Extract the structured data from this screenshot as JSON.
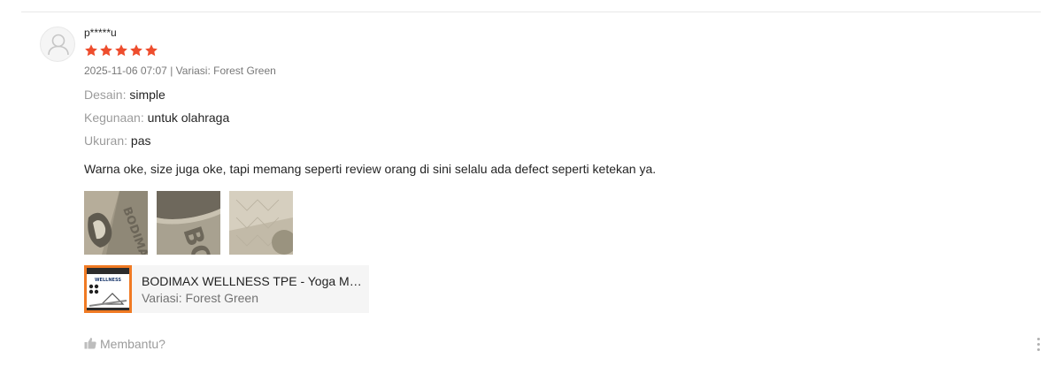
{
  "review": {
    "username": "p*****u",
    "rating": 5,
    "rating_max": 5,
    "star_color": "#ee4d2d",
    "timestamp": "2025-11-06 07:07",
    "separator": " | ",
    "variation_text": "Variasi: Forest Green",
    "attributes": [
      {
        "key": "Desain:",
        "value": "simple"
      },
      {
        "key": "Kegunaan:",
        "value": "untuk olahraga"
      },
      {
        "key": "Ukuran:",
        "value": "pas"
      }
    ],
    "comment": "Warna oke, size juga oke, tapi memang seperti review orang di sini selalu ada defect seperti ketekan ya.",
    "media": [
      {
        "icon": "review-photo-1"
      },
      {
        "icon": "review-photo-2"
      },
      {
        "icon": "review-photo-3"
      }
    ],
    "product": {
      "name": "BODIMAX WELLNESS TPE - Yoga Mat ...",
      "variant": "Variasi: Forest Green",
      "image_text": "WELLNESS"
    },
    "helpful_label": "Membantu?",
    "icons": {
      "avatar": "user-avatar-icon",
      "helpful": "thumbs-up-icon",
      "more": "more-vertical-icon"
    }
  }
}
